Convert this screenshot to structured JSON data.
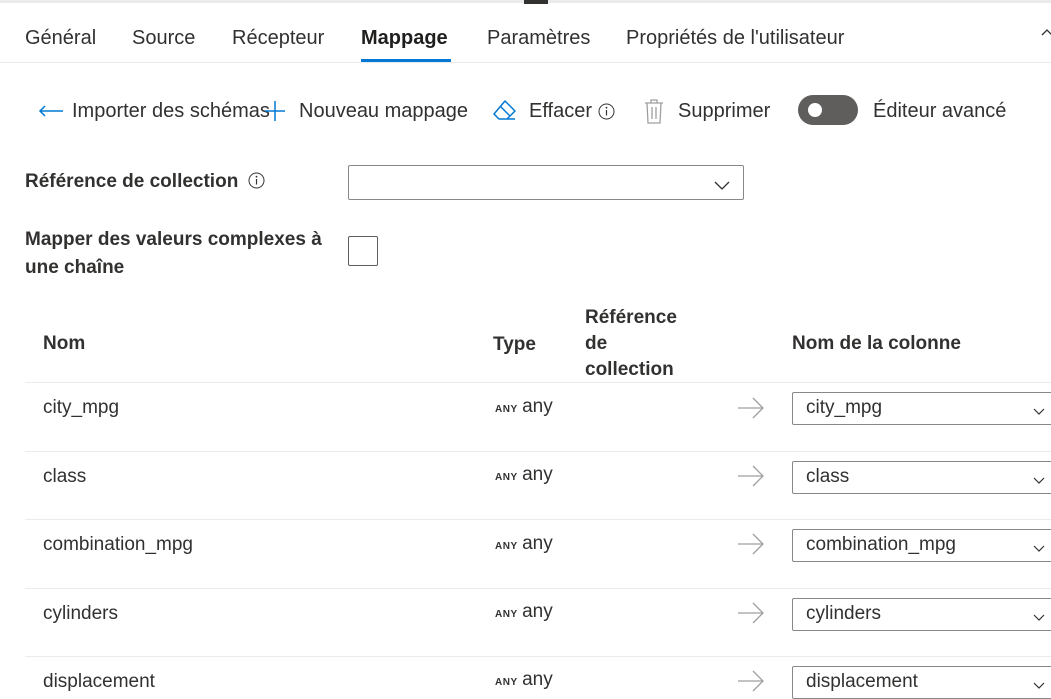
{
  "tabs": [
    "Général",
    "Source",
    "Récepteur",
    "Mappage",
    "Paramètres",
    "Propriétés de l'utilisateur"
  ],
  "toolbar": {
    "import_label": "Importer des schémas",
    "new_mapping_label": "Nouveau mappage",
    "clear_label": "Effacer",
    "delete_label": "Supprimer",
    "advanced_editor_label": "Éditeur avancé",
    "advanced_editor_on": false
  },
  "form": {
    "collection_reference_label": "Référence de collection",
    "collection_reference_value": "",
    "map_complex_label_line1": "Mapper des valeurs complexes à",
    "map_complex_label_line2": "une chaîne",
    "map_complex_checked": false
  },
  "table": {
    "headers": {
      "name": "Nom",
      "type": "Type",
      "collection_ref_line1": "Référence",
      "collection_ref_line2": "de",
      "collection_ref_line3": "collection",
      "column_name": "Nom de la colonne"
    },
    "rows": [
      {
        "name": "city_mpg",
        "type_tag": "ANY",
        "type": "any",
        "column": "city_mpg"
      },
      {
        "name": "class",
        "type_tag": "ANY",
        "type": "any",
        "column": "class"
      },
      {
        "name": "combination_mpg",
        "type_tag": "ANY",
        "type": "any",
        "column": "combination_mpg"
      },
      {
        "name": "cylinders",
        "type_tag": "ANY",
        "type": "any",
        "column": "cylinders"
      },
      {
        "name": "displacement",
        "type_tag": "ANY",
        "type": "any",
        "column": "displacement"
      }
    ]
  },
  "colors": {
    "accent": "#0078d4",
    "toggle_off": "#605e5c",
    "border": "#8a8886",
    "divider": "#edebe9"
  }
}
